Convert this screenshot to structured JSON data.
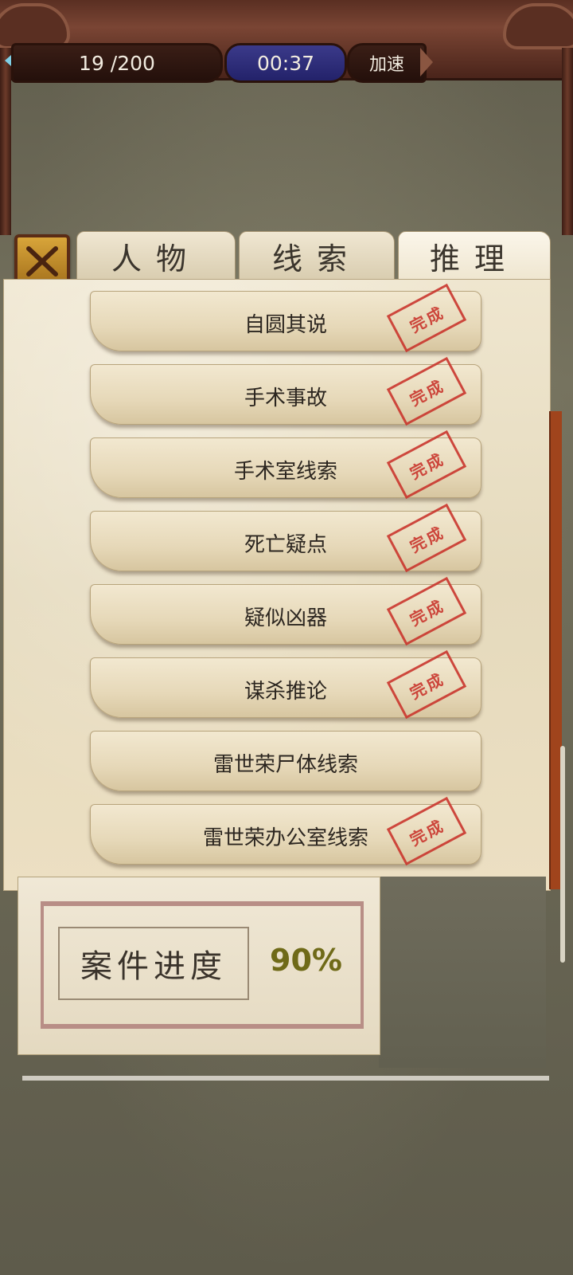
{
  "topbar": {
    "count": "19  /200",
    "timer": "00:37",
    "speed_label": "加速"
  },
  "tabs": [
    {
      "label": "人物"
    },
    {
      "label": "线索"
    },
    {
      "label": "推理"
    }
  ],
  "items": [
    {
      "label": "自圆其说",
      "completed": true
    },
    {
      "label": "手术事故",
      "completed": true
    },
    {
      "label": "手术室线索",
      "completed": true
    },
    {
      "label": "死亡疑点",
      "completed": true
    },
    {
      "label": "疑似凶器",
      "completed": true
    },
    {
      "label": "谋杀推论",
      "completed": true
    },
    {
      "label": "雷世荣尸体线索",
      "completed": false
    },
    {
      "label": "雷世荣办公室线索",
      "completed": true
    }
  ],
  "stamp_text": "完成",
  "progress": {
    "label": "案件进度",
    "value": "90%"
  },
  "colors": {
    "stamp": "#c9322a",
    "timer_bg": "#2e2d7a",
    "frame": "#5a2f22"
  },
  "icons": {
    "close": "close-x-icon"
  }
}
